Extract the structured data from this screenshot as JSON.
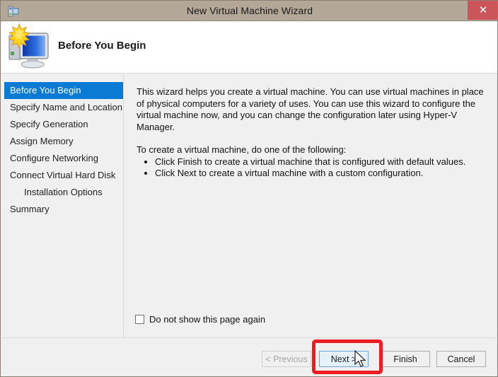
{
  "window": {
    "title": "New Virtual Machine Wizard",
    "title_icon": "vm-wizard-icon",
    "close_label": "✕",
    "close_color": "#cb5558",
    "titlebar_color": "#b3a797"
  },
  "header": {
    "title": "Before You Begin",
    "icon": "computer-monitor-new-icon"
  },
  "sidebar": {
    "selected_color": "#0a7bd4",
    "items": [
      {
        "label": "Before You Begin",
        "selected": true,
        "indent": false
      },
      {
        "label": "Specify Name and Location",
        "selected": false,
        "indent": false
      },
      {
        "label": "Specify Generation",
        "selected": false,
        "indent": false
      },
      {
        "label": "Assign Memory",
        "selected": false,
        "indent": false
      },
      {
        "label": "Configure Networking",
        "selected": false,
        "indent": false
      },
      {
        "label": "Connect Virtual Hard Disk",
        "selected": false,
        "indent": false
      },
      {
        "label": "Installation Options",
        "selected": false,
        "indent": true
      },
      {
        "label": "Summary",
        "selected": false,
        "indent": false
      }
    ]
  },
  "content": {
    "intro_paragraph": "This wizard helps you create a virtual machine. You can use virtual machines in place of physical computers for a variety of uses. You can use this wizard to configure the virtual machine now, and you can change the configuration later using Hyper-V Manager.",
    "instruction_paragraph": "To create a virtual machine, do one of the following:",
    "bullets": [
      "Click Finish to create a virtual machine that is configured with default values.",
      "Click Next to create a virtual machine with a custom configuration."
    ],
    "checkbox_label": "Do not show this page again",
    "checkbox_checked": false
  },
  "footer": {
    "buttons": [
      {
        "label": "< Previous",
        "state": "disabled"
      },
      {
        "label": "Next >",
        "state": "hover"
      },
      {
        "label": "Finish",
        "state": "normal"
      },
      {
        "label": "Cancel",
        "state": "normal"
      }
    ]
  },
  "annotation": {
    "highlight_color": "#ee1c23",
    "target": "Next >"
  }
}
